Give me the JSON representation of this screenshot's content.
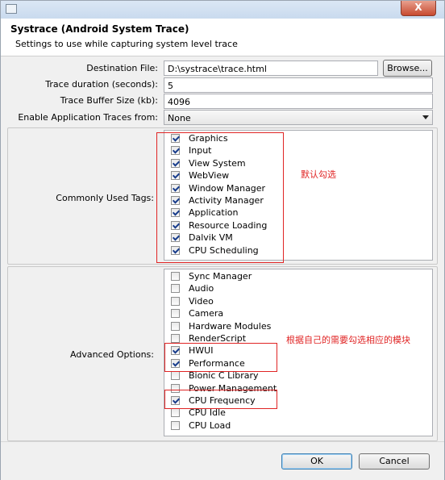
{
  "window": {
    "close_glyph": "X"
  },
  "header": {
    "title": "Systrace (Android System Trace)",
    "subtitle": "Settings to use while capturing system level trace"
  },
  "form": {
    "destination_label": "Destination File:",
    "destination_value": "D:\\systrace\\trace.html",
    "browse_label": "Browse...",
    "duration_label": "Trace duration (seconds):",
    "duration_value": "5",
    "buffer_label": "Trace Buffer Size (kb):",
    "buffer_value": "4096",
    "app_traces_label": "Enable Application Traces from:",
    "app_traces_value": "None"
  },
  "common_tags": {
    "label": "Commonly Used Tags:",
    "annotation": "默认勾选",
    "items": [
      {
        "label": "Graphics",
        "checked": true
      },
      {
        "label": "Input",
        "checked": true
      },
      {
        "label": "View System",
        "checked": true
      },
      {
        "label": "WebView",
        "checked": true
      },
      {
        "label": "Window Manager",
        "checked": true
      },
      {
        "label": "Activity Manager",
        "checked": true
      },
      {
        "label": "Application",
        "checked": true
      },
      {
        "label": "Resource Loading",
        "checked": true
      },
      {
        "label": "Dalvik VM",
        "checked": true
      },
      {
        "label": "CPU Scheduling",
        "checked": true
      }
    ]
  },
  "advanced": {
    "label": "Advanced Options:",
    "annotation": "根据自己的需要勾选相应的模块",
    "items": [
      {
        "label": "Sync Manager",
        "checked": false
      },
      {
        "label": "Audio",
        "checked": false
      },
      {
        "label": "Video",
        "checked": false
      },
      {
        "label": "Camera",
        "checked": false
      },
      {
        "label": "Hardware Modules",
        "checked": false
      },
      {
        "label": "RenderScript",
        "checked": false
      },
      {
        "label": "HWUI",
        "checked": true
      },
      {
        "label": "Performance",
        "checked": true
      },
      {
        "label": "Bionic C Library",
        "checked": false
      },
      {
        "label": "Power Management",
        "checked": false
      },
      {
        "label": "CPU Frequency",
        "checked": true
      },
      {
        "label": "CPU Idle",
        "checked": false
      },
      {
        "label": "CPU Load",
        "checked": false
      }
    ]
  },
  "buttons": {
    "ok": "OK",
    "cancel": "Cancel"
  }
}
